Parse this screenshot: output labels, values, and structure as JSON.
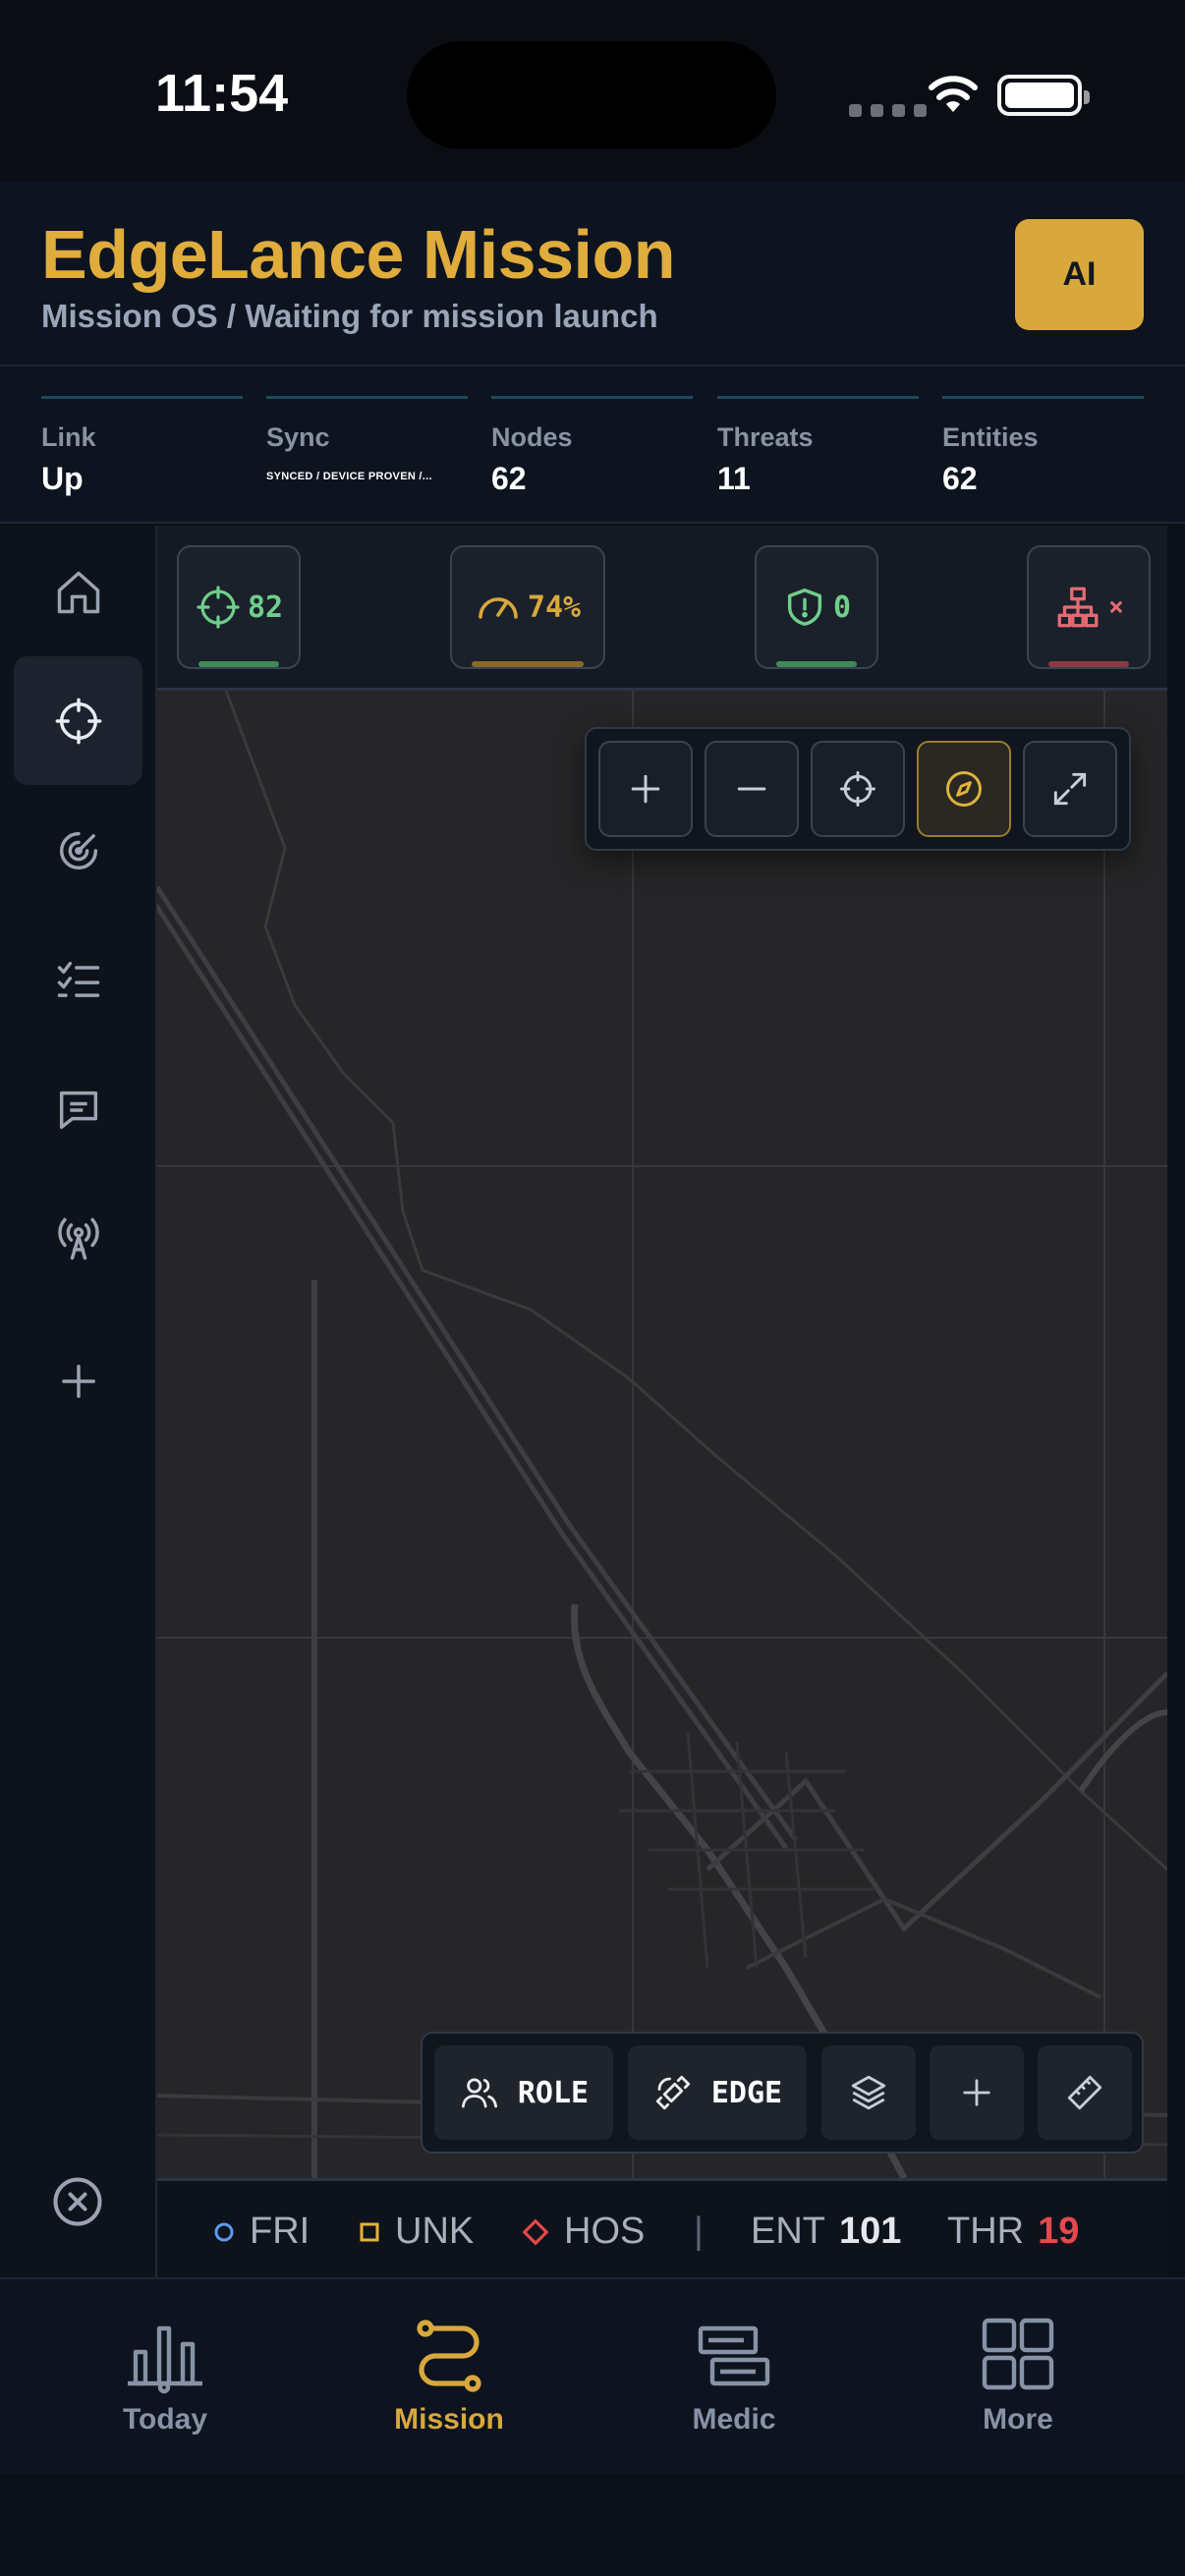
{
  "status_bar": {
    "time": "11:54"
  },
  "header": {
    "title": "EdgeLance Mission",
    "subtitle": "Mission OS / Waiting for mission launch",
    "ai_button_label": "AI"
  },
  "stats": [
    {
      "label": "Link",
      "value": "Up"
    },
    {
      "label": "Sync",
      "value": "SYNCED / DEVICE PROVEN /..."
    },
    {
      "label": "Nodes",
      "value": "62"
    },
    {
      "label": "Threats",
      "value": "11"
    },
    {
      "label": "Entities",
      "value": "62"
    }
  ],
  "rail": {
    "items": [
      {
        "icon": "home-icon",
        "active": false
      },
      {
        "icon": "crosshair-icon",
        "active": true
      },
      {
        "icon": "radar-icon",
        "active": false
      },
      {
        "icon": "checklist-icon",
        "active": false
      },
      {
        "icon": "message-icon",
        "active": false
      },
      {
        "icon": "antenna-icon",
        "active": false
      },
      {
        "icon": "plus-icon",
        "active": false
      }
    ],
    "bottom_icon": "close-circle-icon"
  },
  "map_status": {
    "readiness": {
      "value": "82",
      "color": "#6fcf8a"
    },
    "speed": {
      "value": "74%",
      "color": "#d9a83c"
    },
    "shield": {
      "value": "0",
      "color": "#6fcf8a"
    },
    "network": {
      "value": "×",
      "color": "#e56a72"
    }
  },
  "map_controls": [
    "zoom-in-icon",
    "zoom-out-icon",
    "locate-icon",
    "compass-icon",
    "expand-icon"
  ],
  "map_tools": {
    "role_label": "ROLE",
    "edge_label": "EDGE"
  },
  "legend": {
    "friendly": "FRI",
    "unknown": "UNK",
    "hostile": "HOS",
    "separator": "|",
    "entities_label": "ENT",
    "entities_value": "101",
    "threats_label": "THR",
    "threats_value": "19"
  },
  "colors": {
    "accent": "#d9a83c",
    "friendly": "#5b9cf0",
    "unknown": "#e0b43c",
    "hostile": "#e5484d"
  },
  "tabs": [
    {
      "label": "Today",
      "icon": "chart-icon",
      "active": false
    },
    {
      "label": "Mission",
      "icon": "route-icon",
      "active": true
    },
    {
      "label": "Medic",
      "icon": "cards-icon",
      "active": false
    },
    {
      "label": "More",
      "icon": "grid-icon",
      "active": false
    }
  ]
}
